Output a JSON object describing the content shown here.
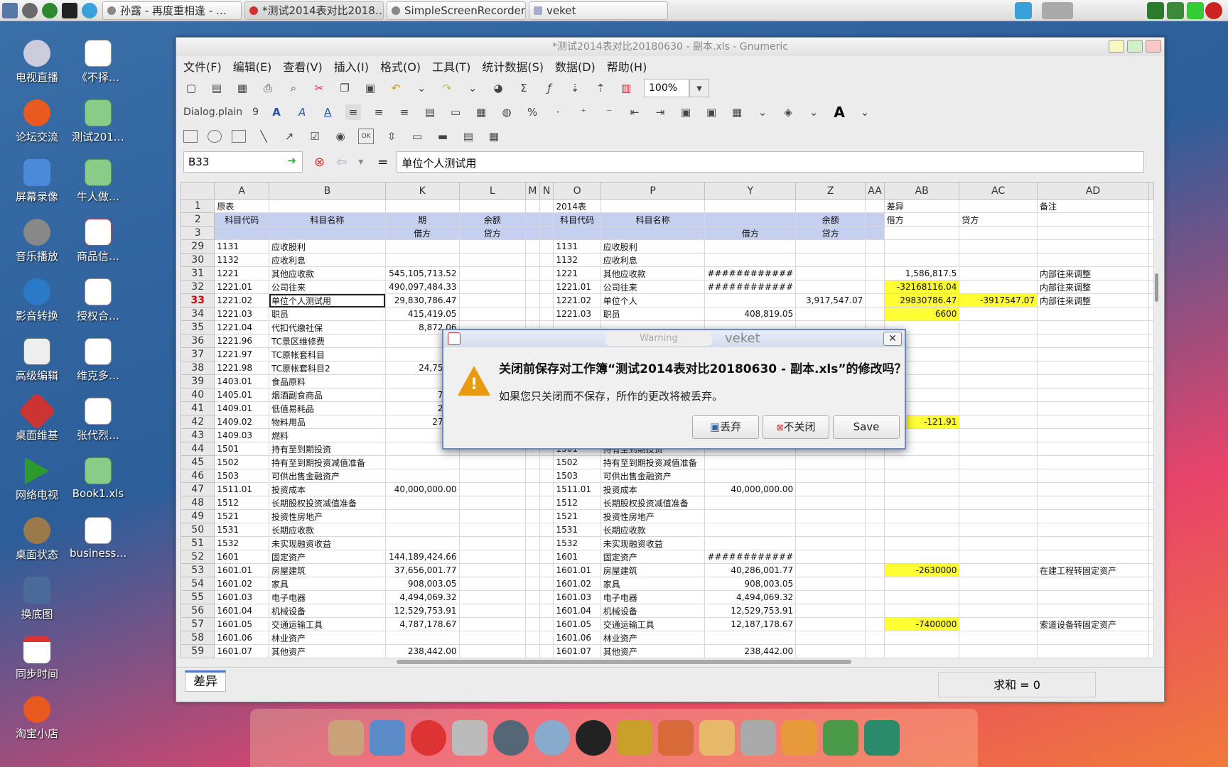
{
  "taskbar": {
    "tasks": [
      "孙露 - 再度重相逢 - …",
      "*测试2014表对比2018…",
      "SimpleScreenRecorder",
      "veket"
    ]
  },
  "desktop_icons": [
    "电视直播",
    "《不择…",
    "论坛交流",
    "测试201…",
    "屏幕录像",
    "牛人做…",
    "音乐播放",
    "商品信…",
    "影音转换",
    "授权合…",
    "高级编辑",
    "维克多…",
    "桌面维基",
    "张代烈…",
    "网络电视",
    "Book1.xls",
    "桌面状态",
    "business…",
    "换底图",
    "同步时间",
    "淘宝小店"
  ],
  "window": {
    "title": "*测试2014表对比20180630 - 副本.xls - Gnumeric",
    "menu": [
      "文件(F)",
      "编辑(E)",
      "查看(V)",
      "插入(I)",
      "格式(O)",
      "工具(T)",
      "统计数据(S)",
      "数据(D)",
      "帮助(H)"
    ],
    "zoom": "100%",
    "font_name": "Dialog.plain",
    "font_size": "9",
    "cell_ref": "B33",
    "formula": "单位个人测试用",
    "bold_glyph": "A"
  },
  "columns": [
    "A",
    "B",
    "K",
    "L",
    "M",
    "N",
    "O",
    "P",
    "Y",
    "Z",
    "AA",
    "AB",
    "AC",
    "AD"
  ],
  "header_rows": {
    "r1": {
      "A": "原表",
      "O": "2014表",
      "AB": "差异",
      "AD": "备注"
    },
    "r2": {
      "A": "科目代码",
      "B": "科目名称",
      "K": "期",
      "L": "余额",
      "O": "科目代码",
      "P": "科目名称",
      "Z": "余额",
      "AB": "借方",
      "AC": "贷方"
    },
    "r3": {
      "K": "借方",
      "L": "贷方",
      "Y": "借方",
      "Z": "贷方"
    }
  },
  "rows": [
    {
      "n": "29",
      "A": "1131",
      "B": "应收股利",
      "O": "1131",
      "P": "应收股利"
    },
    {
      "n": "30",
      "A": "1132",
      "B": "应收利息",
      "O": "1132",
      "P": "应收利息"
    },
    {
      "n": "31",
      "A": "1221",
      "B": "其他应收款",
      "K": "545,105,713.52",
      "O": "1221",
      "P": "其他应收款",
      "Y": "############",
      "AB": "1,586,817.5",
      "AD": "内部往来调整"
    },
    {
      "n": "32",
      "A": "1221.01",
      "B": "公司往来",
      "K": "490,097,484.33",
      "O": "1221.01",
      "P": "公司往来",
      "Y": "############",
      "AB": "-32168116.04",
      "ABy": true,
      "AD": "内部往来调整"
    },
    {
      "n": "33",
      "A": "1221.02",
      "B": "单位个人测试用",
      "K": "29,830,786.47",
      "O": "1221.02",
      "P": "单位个人",
      "Z": "3,917,547.07",
      "AB": "29830786.47",
      "ABy": true,
      "AC": "-3917547.07",
      "ACy": true,
      "AD": "内部往来调整",
      "sel": true
    },
    {
      "n": "34",
      "A": "1221.03",
      "B": "职员",
      "K": "415,419.05",
      "O": "1221.03",
      "P": "职员",
      "Y": "408,819.05",
      "AB": "6600",
      "ABy": true
    },
    {
      "n": "35",
      "A": "1221.04",
      "B": "代扣代缴社保",
      "K": "8,872.06"
    },
    {
      "n": "36",
      "A": "1221.96",
      "B": "TC景区维修费"
    },
    {
      "n": "37",
      "A": "1221.97",
      "B": "TC原帐套科目"
    },
    {
      "n": "38",
      "A": "1221.98",
      "B": "TC原帐套科目2",
      "K": "24,753,1"
    },
    {
      "n": "39",
      "A": "1403.01",
      "B": "食品原料",
      "K": "1,2"
    },
    {
      "n": "40",
      "A": "1405.01",
      "B": "烟酒副食商品",
      "K": "75,7"
    },
    {
      "n": "41",
      "A": "1409.01",
      "B": "低值易耗品",
      "K": "24,2"
    },
    {
      "n": "42",
      "A": "1409.02",
      "B": "物料用品",
      "K": "272,7",
      "AB": "-121.91",
      "ABy": true
    },
    {
      "n": "43",
      "A": "1409.03",
      "B": "燃料",
      "K": "5,0"
    },
    {
      "n": "44",
      "A": "1501",
      "B": "持有至到期投资",
      "O": "1501",
      "P": "持有至到期投资"
    },
    {
      "n": "45",
      "A": "1502",
      "B": "持有至到期投资减值准备",
      "O": "1502",
      "P": "持有至到期投资减值准备"
    },
    {
      "n": "46",
      "A": "1503",
      "B": "可供出售金融资产",
      "O": "1503",
      "P": "可供出售金融资产"
    },
    {
      "n": "47",
      "A": "1511.01",
      "B": "投资成本",
      "K": "40,000,000.00",
      "O": "1511.01",
      "P": "投资成本",
      "Y": "40,000,000.00"
    },
    {
      "n": "48",
      "A": "1512",
      "B": "长期股权投资减值准备",
      "O": "1512",
      "P": "长期股权投资减值准备"
    },
    {
      "n": "49",
      "A": "1521",
      "B": "投资性房地产",
      "O": "1521",
      "P": "投资性房地产"
    },
    {
      "n": "50",
      "A": "1531",
      "B": "长期应收款",
      "O": "1531",
      "P": "长期应收款"
    },
    {
      "n": "51",
      "A": "1532",
      "B": "未实现融资收益",
      "O": "1532",
      "P": "未实现融资收益"
    },
    {
      "n": "52",
      "A": "1601",
      "B": "固定资产",
      "K": "144,189,424.66",
      "O": "1601",
      "P": "固定资产",
      "Y": "############"
    },
    {
      "n": "53",
      "A": "1601.01",
      "B": "房屋建筑",
      "K": "37,656,001.77",
      "O": "1601.01",
      "P": "房屋建筑",
      "Y": "40,286,001.77",
      "AB": "-2630000",
      "ABy": true,
      "AD": "在建工程转固定资产"
    },
    {
      "n": "54",
      "A": "1601.02",
      "B": "家具",
      "K": "908,003.05",
      "O": "1601.02",
      "P": "家具",
      "Y": "908,003.05"
    },
    {
      "n": "55",
      "A": "1601.03",
      "B": "电子电器",
      "K": "4,494,069.32",
      "O": "1601.03",
      "P": "电子电器",
      "Y": "4,494,069.32"
    },
    {
      "n": "56",
      "A": "1601.04",
      "B": "机械设备",
      "K": "12,529,753.91",
      "O": "1601.04",
      "P": "机械设备",
      "Y": "12,529,753.91"
    },
    {
      "n": "57",
      "A": "1601.05",
      "B": "交通运输工具",
      "K": "4,787,178.67",
      "O": "1601.05",
      "P": "交通运输工具",
      "Y": "12,187,178.67",
      "AB": "-7400000",
      "ABy": true,
      "AD": "索道设备转固定资产"
    },
    {
      "n": "58",
      "A": "1601.06",
      "B": "林业资产",
      "O": "1601.06",
      "P": "林业资产"
    },
    {
      "n": "59",
      "A": "1601.07",
      "B": "其他资产",
      "K": "238,442.00",
      "O": "1601.07",
      "P": "其他资产",
      "Y": "238,442.00"
    }
  ],
  "sheet_tab": "差异",
  "status_sum": "求和 = 0",
  "dialog": {
    "title_left": "Warning",
    "title_right": "veket",
    "close": "✕",
    "question": "关闭前保存对工作簿“测试2014表对比20180630 - 副本.xls”的修改吗？",
    "detail": "如果您只关闭而不保存，所作的更改将被丢弃。",
    "discard": "丢弃",
    "dont_close": "不关闭",
    "save": "Save",
    "warn_glyph": "!"
  }
}
